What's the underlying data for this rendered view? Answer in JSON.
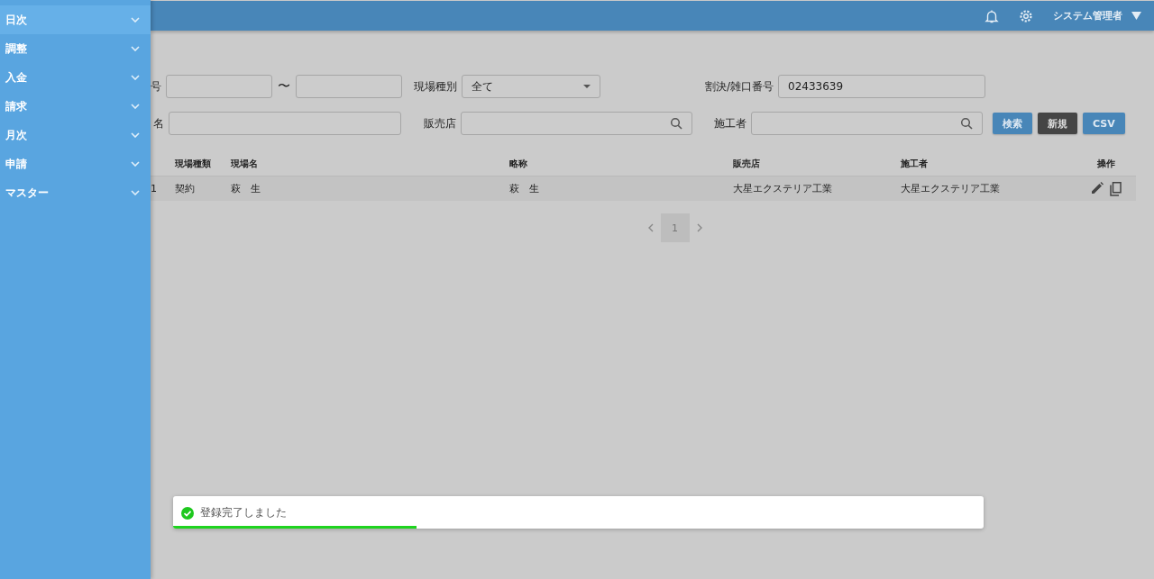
{
  "sidebar": {
    "items": [
      {
        "label": "日次",
        "hovered": true
      },
      {
        "label": "調整",
        "hovered": false
      },
      {
        "label": "入金",
        "hovered": false
      },
      {
        "label": "請求",
        "hovered": false
      },
      {
        "label": "月次",
        "hovered": false
      },
      {
        "label": "申請",
        "hovered": false
      },
      {
        "label": "マスター",
        "hovered": false
      }
    ]
  },
  "header": {
    "user": "システム管理者"
  },
  "filters": {
    "row1": [
      {
        "kind": "label",
        "text": "号"
      },
      {
        "kind": "input"
      },
      {
        "kind": "sep",
        "text": "〜"
      },
      {
        "kind": "input"
      },
      {
        "kind": "label",
        "text": "現場種別"
      },
      {
        "kind": "select",
        "value": "全て"
      },
      {
        "kind": "label",
        "text": "割決/雑口番号"
      },
      {
        "kind": "input",
        "value": "02433639"
      }
    ],
    "row2": [
      {
        "kind": "label",
        "text": "名"
      },
      {
        "kind": "input"
      },
      {
        "kind": "label",
        "text": "販売店"
      },
      {
        "kind": "search"
      },
      {
        "kind": "label",
        "text": "施工者"
      },
      {
        "kind": "search"
      },
      {
        "kind": "button",
        "text": "検索"
      },
      {
        "kind": "button",
        "text": "新規"
      },
      {
        "kind": "button",
        "text": "CSV"
      }
    ]
  },
  "table": {
    "columns": [
      "",
      "現場種類",
      "現場名",
      "略称",
      "販売店",
      "施工者",
      "操作"
    ],
    "rows": [
      {
        "cells": [
          "1",
          "契約",
          "萩　生",
          "萩　生",
          "大星エクステリア工業",
          "大星エクステリア工業"
        ]
      }
    ]
  },
  "pagination": {
    "pages": [
      {
        "label": "1",
        "selected": true
      }
    ]
  },
  "toast": {
    "message": "登録完了しました",
    "level": 0.3
  }
}
